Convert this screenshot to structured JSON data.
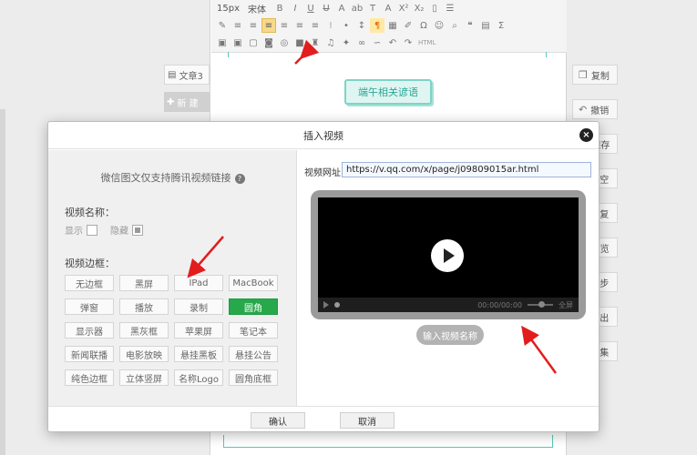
{
  "toolbar": {
    "font_size": "15px",
    "font_family": "宋体",
    "html_label": "HTML"
  },
  "left_panel": {
    "doc_tab": "文章3",
    "new_button": "新 建"
  },
  "editor": {
    "tag_text": "端午相关谚语"
  },
  "right_panel": {
    "buttons": [
      {
        "icon": "copy-icon",
        "label": "复制"
      },
      {
        "icon": "undo-icon",
        "label": "撤销"
      },
      {
        "icon": "save-icon",
        "label": "保存"
      },
      {
        "icon": "clear-icon",
        "label": "清空"
      },
      {
        "icon": "restore-icon",
        "label": "恢复"
      },
      {
        "icon": "preview-icon",
        "label": "预览"
      },
      {
        "icon": "sync-icon",
        "label": "同步"
      },
      {
        "icon": "export-icon",
        "label": "导出"
      },
      {
        "icon": "collect-icon",
        "label": "采集"
      }
    ]
  },
  "modal": {
    "title": "插入视频",
    "close_label": "×",
    "tip": "微信图文仅支持腾讯视频链接",
    "video_name_label": "视频名称：",
    "show_label": "显示",
    "hide_label": "隐藏",
    "frame_label": "视频边框：",
    "frames": [
      [
        "无边框",
        "黑屏",
        "IPad",
        "MacBook"
      ],
      [
        "弹窗",
        "播放",
        "录制",
        "圆角"
      ],
      [
        "显示器",
        "黑灰框",
        "苹果屏",
        "笔记本"
      ],
      [
        "新闻联播",
        "电影放映",
        "悬挂黑板",
        "悬挂公告"
      ],
      [
        "纯色边框",
        "立体竖屏",
        "名称Logo",
        "圆角底框"
      ]
    ],
    "selected_frame": "圆角",
    "url_label": "视频网址",
    "url_value": "https://v.qq.com/x/page/j09809015ar.html",
    "time_display": "00:00/00:00",
    "fullscreen_label": "全屏",
    "name_pill": "输入视频名称",
    "ok_label": "确认",
    "cancel_label": "取消"
  },
  "colors": {
    "accent_green": "#27a94b",
    "teal": "#59c7b9",
    "arrow_red": "#e21d1d"
  }
}
